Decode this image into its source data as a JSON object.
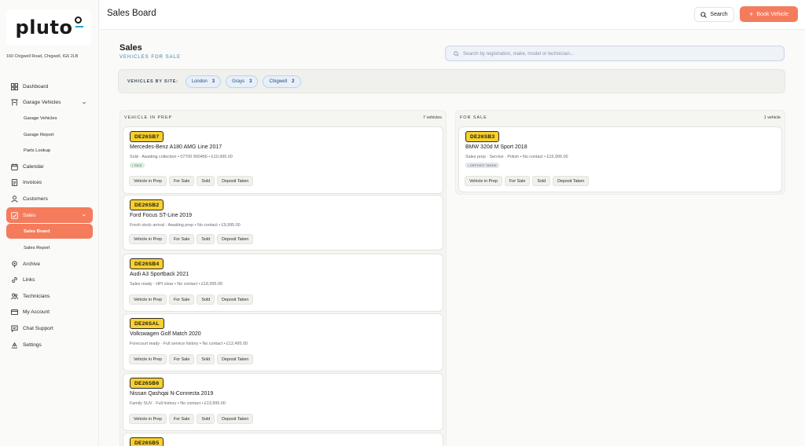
{
  "brand": {
    "name": "pluto"
  },
  "sidebar": {
    "address": "160 Chigwell Road, Chigwell, IG6 2LB",
    "items": [
      {
        "label": "Dashboard",
        "icon": "grid-icon"
      },
      {
        "label": "Garage Vehicles",
        "icon": "car-lift-icon"
      },
      {
        "label": "Garage Vehicles",
        "icon": ""
      },
      {
        "label": "Garage Report",
        "icon": ""
      },
      {
        "label": "Parts Lookup",
        "icon": ""
      },
      {
        "label": "Calendar",
        "icon": "calendar-icon"
      },
      {
        "label": "Invoices",
        "icon": "invoice-icon"
      },
      {
        "label": "Customers",
        "icon": "user-icon"
      },
      {
        "label": "Sales",
        "icon": "sales-icon"
      },
      {
        "label": "Sales Board",
        "icon": ""
      },
      {
        "label": "Sales Report",
        "icon": ""
      },
      {
        "label": "Archive",
        "icon": "archive-icon"
      },
      {
        "label": "Links",
        "icon": "link-icon"
      },
      {
        "label": "Technicians",
        "icon": "technicians-icon"
      },
      {
        "label": "My Account",
        "icon": "card-icon"
      },
      {
        "label": "Chat Support",
        "icon": "chat-icon"
      },
      {
        "label": "Settings",
        "icon": "settings-icon"
      }
    ]
  },
  "topbar": {
    "title": "Sales Board",
    "search_label": "Search",
    "book_label": "Book Vehicle"
  },
  "main": {
    "title": "Sales",
    "subtitle": "VEHICLES FOR SALE",
    "search_placeholder": "Search by registration, make, model or technician..."
  },
  "sites": {
    "label": "VEHICLES BY SITE:",
    "chips": [
      {
        "name": "London",
        "count": "3"
      },
      {
        "name": "Grays",
        "count": "3"
      },
      {
        "name": "Chigwell",
        "count": "2"
      }
    ]
  },
  "columns": {
    "prep": {
      "title": "VEHICLE IN PREP",
      "count": "7 vehicles",
      "cards": [
        {
          "plate": "DE26SB7",
          "name": "Mercedes-Benz A180 AMG Line 2017",
          "meta": "Sold · Awaiting collection   •  07700 900456   •  £10,995.00",
          "badge": "• PAID"
        },
        {
          "plate": "DE26SB2",
          "name": "Ford Focus ST-Line 2019",
          "meta": "Fresh stock arrival · Awaiting prep   •  No contact   •  £9,995.00",
          "badge": ""
        },
        {
          "plate": "DE26SB4",
          "name": "Audi A3 Sportback 2021",
          "meta": "Sales ready · HPI clear   •  No contact   •  £18,995.00",
          "badge": ""
        },
        {
          "plate": "DE26SAL",
          "name": "Volkswagen Golf Match 2020",
          "meta": "Forecourt ready · Full service history   •  No contact   •  £12,495.00",
          "badge": ""
        },
        {
          "plate": "DE26SB6",
          "name": "Nissan Qashqai N-Connecta 2019",
          "meta": "Family SUV · Full history   •  No contact   •  £13,995.00",
          "badge": ""
        },
        {
          "plate": "DE26SB5",
          "name": "",
          "meta": "",
          "badge": ""
        }
      ]
    },
    "forsale": {
      "title": "FOR SALE",
      "count": "1 vehicle",
      "cards": [
        {
          "plate": "DE26SB3",
          "name": "BMW 320d M Sport 2018",
          "meta": "Sales prep · Service · Polish   •  No contact   •  £15,995.00",
          "badge": "• DEPOSIT TAKEN"
        }
      ]
    }
  },
  "card_actions": [
    "Vehicle in Prep",
    "For Sale",
    "Sold",
    "Deposit Taken"
  ],
  "colors": {
    "accent": "#f47c5c",
    "plate": "#f8d12e",
    "link": "#3a7fae"
  }
}
